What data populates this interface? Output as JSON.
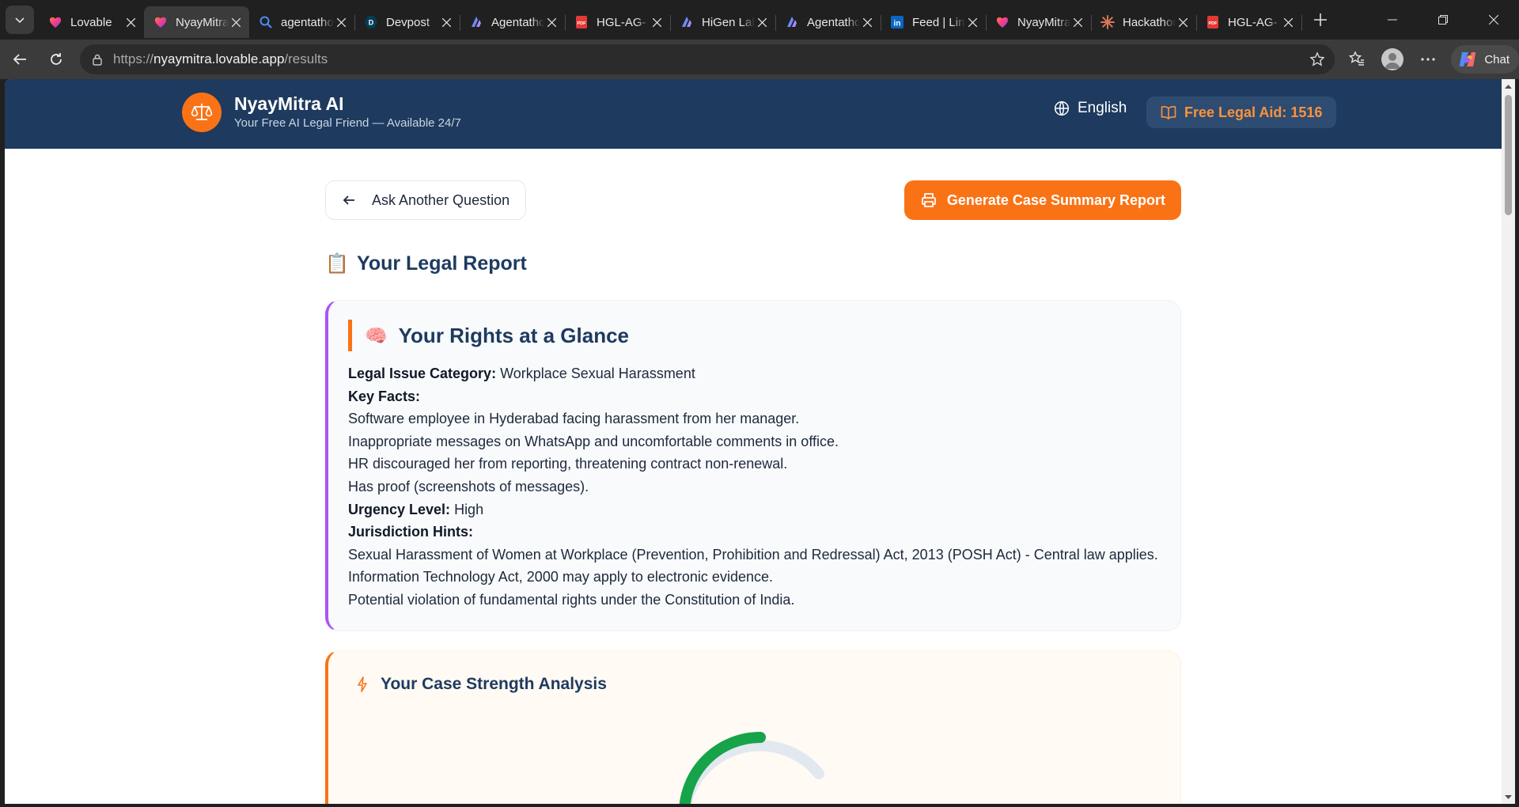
{
  "browser": {
    "tabs": [
      {
        "title": "Lovable",
        "favicon": "lovable-heart",
        "active": false
      },
      {
        "title": "NyayMitra",
        "favicon": "lovable-heart",
        "active": true
      },
      {
        "title": "agentathon",
        "favicon": "search-icon",
        "active": false
      },
      {
        "title": "Devpost",
        "favicon": "devpost",
        "active": false
      },
      {
        "title": "Agentathon",
        "favicon": "agentathon-logo",
        "active": false
      },
      {
        "title": "HGL-AG-",
        "favicon": "pdf-icon",
        "active": false
      },
      {
        "title": "HiGen Lab",
        "favicon": "agentathon-logo",
        "active": false
      },
      {
        "title": "Agentathon",
        "favicon": "agentathon-logo",
        "active": false
      },
      {
        "title": "Feed | LinkedIn",
        "favicon": "linkedin",
        "active": false
      },
      {
        "title": "NyayMitra",
        "favicon": "lovable-heart",
        "active": false
      },
      {
        "title": "Hackathon",
        "favicon": "claude-burst",
        "active": false
      },
      {
        "title": "HGL-AG-",
        "favicon": "pdf-icon",
        "active": false
      }
    ],
    "url_prefix": "https://",
    "url_host": "nyaymitra.lovable.app",
    "url_path": "/results",
    "chat_label": "Chat"
  },
  "app": {
    "name": "NyayMitra AI",
    "tagline": "Your Free AI Legal Friend — Available 24/7",
    "language": "English",
    "legal_aid_badge": "Free Legal Aid: 1516",
    "colors": {
      "navy": "#1e3a5f",
      "orange": "#f97316",
      "purple": "#a855f7"
    }
  },
  "actions": {
    "ask_another": "Ask Another Question",
    "generate_report": "Generate Case Summary Report"
  },
  "report": {
    "emoji": "📋",
    "title": "Your Legal Report",
    "rights": {
      "emoji": "🧠",
      "heading": "Your Rights at a Glance",
      "category_label": "Legal Issue Category:",
      "category_value": " Workplace Sexual Harassment",
      "key_facts_label": "Key Facts:",
      "key_facts": [
        "Software employee in Hyderabad facing harassment from her manager.",
        "Inappropriate messages on WhatsApp and uncomfortable comments in office.",
        "HR discouraged her from reporting, threatening contract non-renewal.",
        "Has proof (screenshots of messages)."
      ],
      "urgency_label": "Urgency Level:",
      "urgency_value": " High",
      "jurisdiction_label": "Jurisdiction Hints:",
      "jurisdiction": [
        "Sexual Harassment of Women at Workplace (Prevention, Prohibition and Redressal) Act, 2013 (POSH Act) - Central law applies.",
        "Information Technology Act, 2000 may apply to electronic evidence.",
        "Potential violation of fundamental rights under the Constitution of India."
      ]
    },
    "strength": {
      "heading": "Your Case Strength Analysis",
      "gauge_colors": {
        "fill": "#16a34a",
        "track": "#e2e8f0"
      }
    }
  }
}
